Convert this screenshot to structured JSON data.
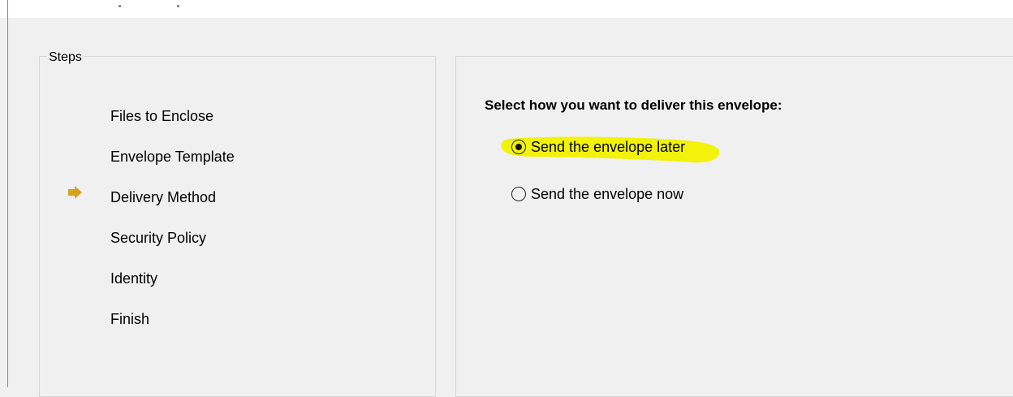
{
  "steps": {
    "title": "Steps",
    "items": [
      {
        "label": "Files to Enclose",
        "current": false
      },
      {
        "label": "Envelope Template",
        "current": false
      },
      {
        "label": "Delivery Method",
        "current": true
      },
      {
        "label": "Security Policy",
        "current": false
      },
      {
        "label": "Identity",
        "current": false
      },
      {
        "label": "Finish",
        "current": false
      }
    ],
    "current_arrow_icon": "arrow-right-icon",
    "arrow_color": "#d4a21c"
  },
  "delivery": {
    "prompt": "Select how you want to deliver this envelope:",
    "options": [
      {
        "label": "Send the envelope later",
        "selected": true
      },
      {
        "label": "Send the envelope now",
        "selected": false
      }
    ],
    "highlight_color": "#f2f20a"
  }
}
